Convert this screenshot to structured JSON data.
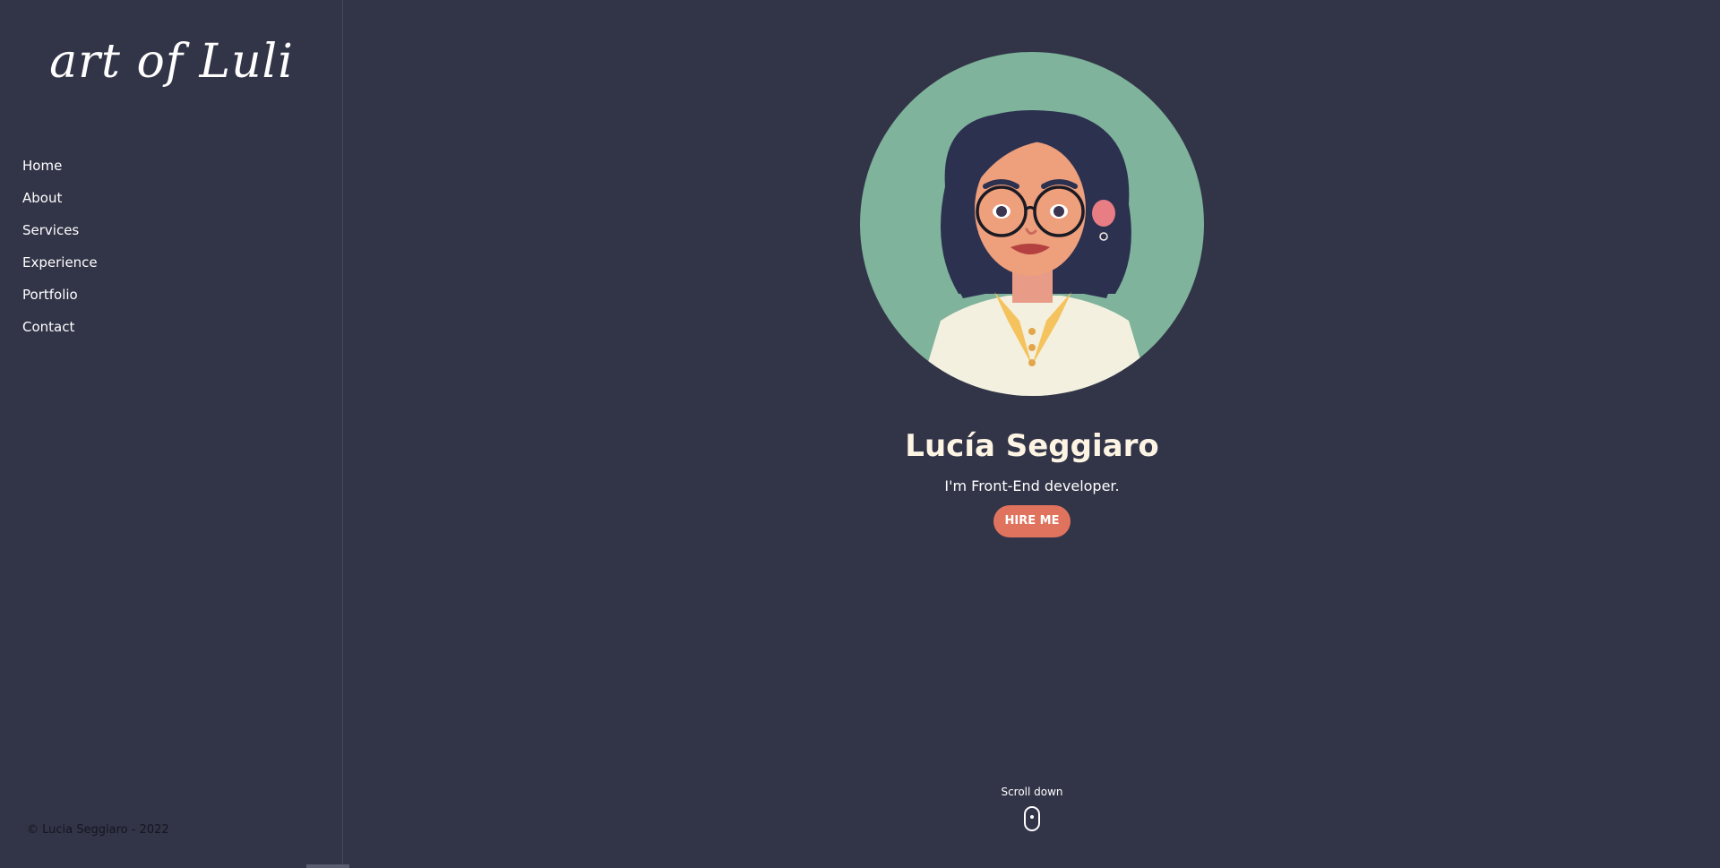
{
  "sidebar": {
    "logo": "art of Luli",
    "nav": [
      "Home",
      "About",
      "Services",
      "Experience",
      "Portfolio",
      "Contact"
    ],
    "copyright": "© Lucia Seggiaro - 2022"
  },
  "hero": {
    "avatar_icon": "woman-with-glasses-illustration",
    "name": "Lucía Seggiaro",
    "tagline": "I'm Front-End developer.",
    "cta_label": "HIRE ME"
  },
  "scroll": {
    "label": "Scroll down",
    "icon": "mouse-scroll-icon"
  },
  "colors": {
    "background": "#323448",
    "accent": "#e0735e",
    "name_text": "#fdf4e3",
    "avatar_bg": "#7fb39b"
  }
}
